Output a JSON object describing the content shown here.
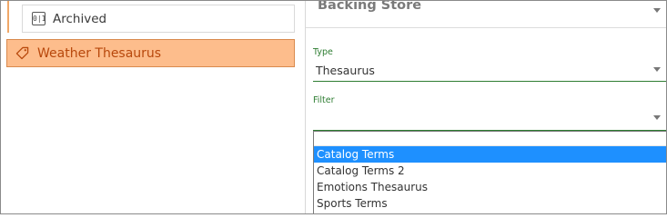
{
  "tree": {
    "archived_label": "Archived",
    "archived_icon": "archive-box-icon",
    "selected_label": "Weather Thesaurus",
    "selected_icon": "tag-icon"
  },
  "panel": {
    "section_title": "Backing Store",
    "type_label": "Type",
    "type_value": "Thesaurus",
    "filter_label": "Filter",
    "filter_value": ""
  },
  "dropdown": {
    "options": [
      {
        "label": "Catalog Terms",
        "selected": true
      },
      {
        "label": "Catalog Terms 2",
        "selected": false
      },
      {
        "label": "Emotions Thesaurus",
        "selected": false
      },
      {
        "label": "Sports Terms",
        "selected": false
      }
    ]
  },
  "colors": {
    "selected_bg": "#fdbd8c",
    "selected_text": "#b8480c",
    "field_green": "#2e7d32",
    "option_highlight": "#1e90ff"
  }
}
